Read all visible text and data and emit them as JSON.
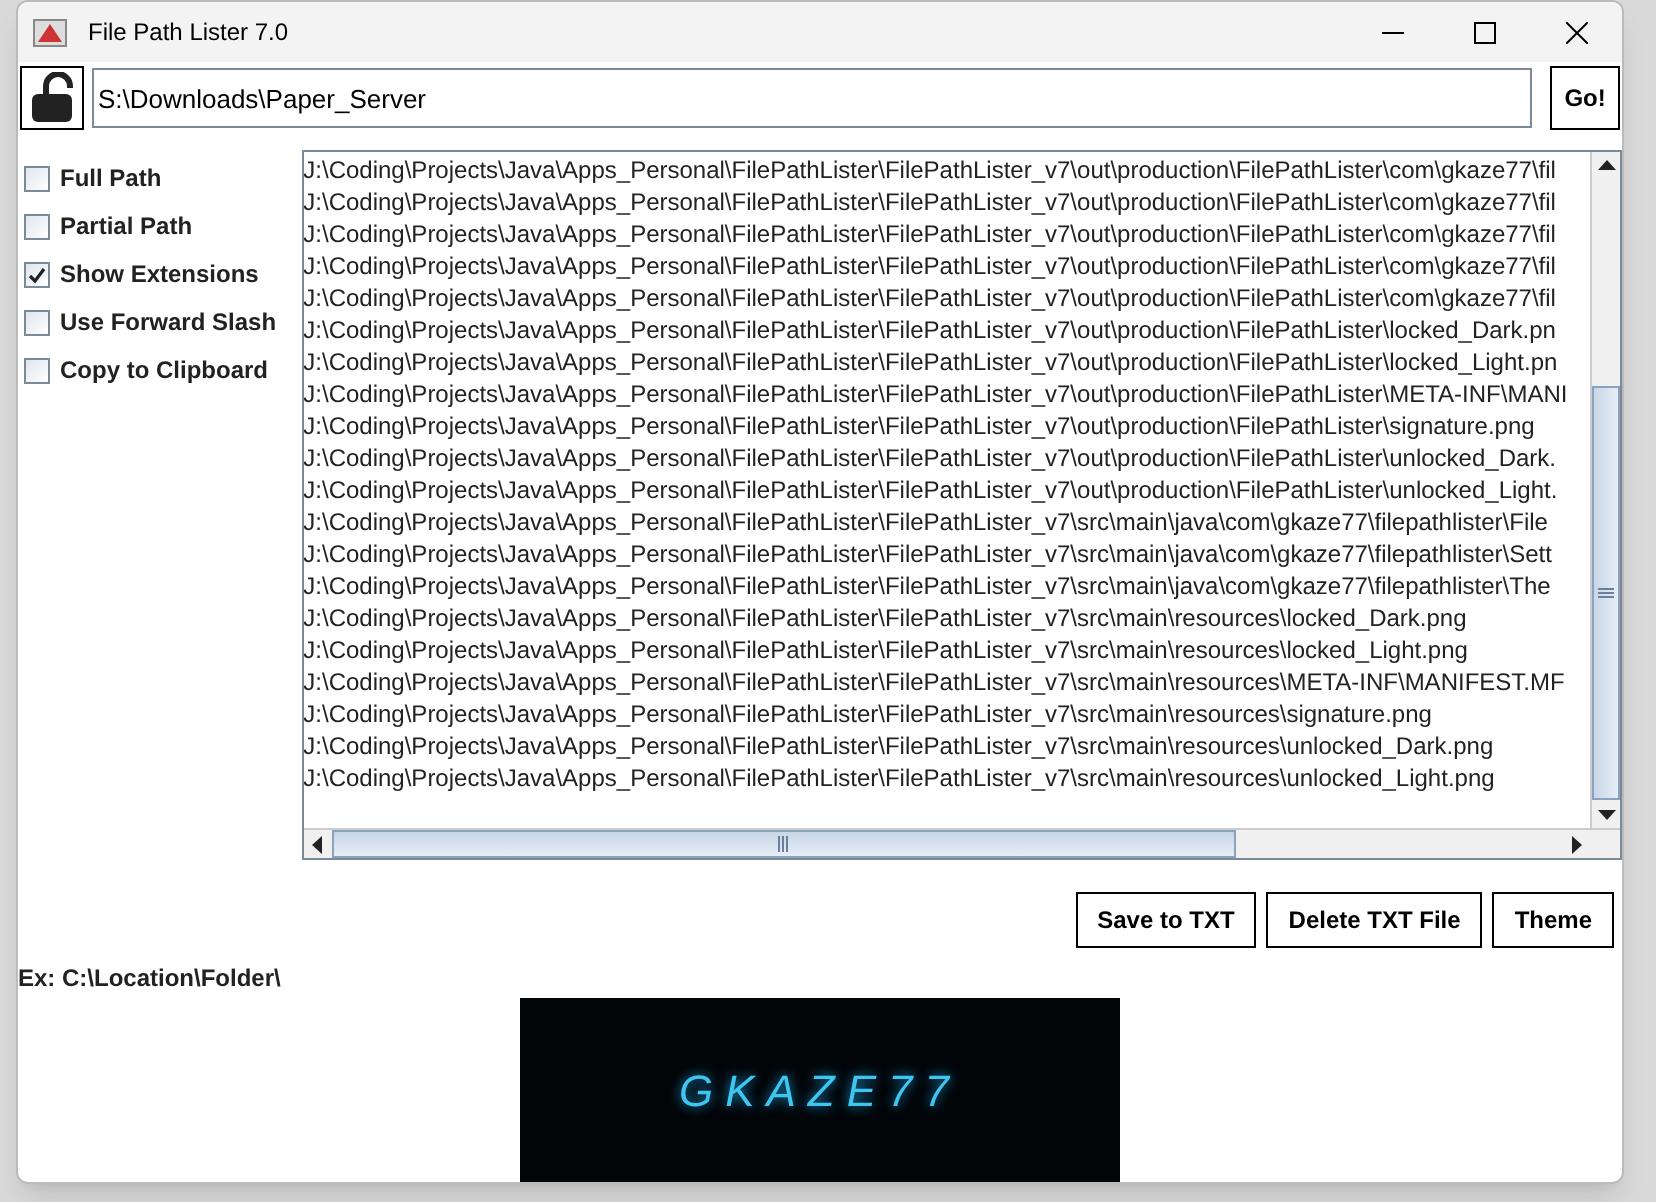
{
  "window": {
    "title": "File Path Lister 7.0"
  },
  "path_field": {
    "value": "S:\\Downloads\\Paper_Server"
  },
  "lock": {
    "locked": false
  },
  "go_button": "Go!",
  "options": [
    {
      "label": "Full Path",
      "checked": false
    },
    {
      "label": "Partial Path",
      "checked": false
    },
    {
      "label": "Show Extensions",
      "checked": true
    },
    {
      "label": "Use Forward Slash",
      "checked": false
    },
    {
      "label": "Copy to Clipboard",
      "checked": false
    }
  ],
  "file_list": [
    "J:\\Coding\\Projects\\Java\\Apps_Personal\\FilePathLister\\FilePathLister_v7\\out\\production\\FilePathLister\\com\\gkaze77\\fil",
    "J:\\Coding\\Projects\\Java\\Apps_Personal\\FilePathLister\\FilePathLister_v7\\out\\production\\FilePathLister\\com\\gkaze77\\fil",
    "J:\\Coding\\Projects\\Java\\Apps_Personal\\FilePathLister\\FilePathLister_v7\\out\\production\\FilePathLister\\com\\gkaze77\\fil",
    "J:\\Coding\\Projects\\Java\\Apps_Personal\\FilePathLister\\FilePathLister_v7\\out\\production\\FilePathLister\\com\\gkaze77\\fil",
    "J:\\Coding\\Projects\\Java\\Apps_Personal\\FilePathLister\\FilePathLister_v7\\out\\production\\FilePathLister\\com\\gkaze77\\fil",
    "J:\\Coding\\Projects\\Java\\Apps_Personal\\FilePathLister\\FilePathLister_v7\\out\\production\\FilePathLister\\locked_Dark.pn",
    "J:\\Coding\\Projects\\Java\\Apps_Personal\\FilePathLister\\FilePathLister_v7\\out\\production\\FilePathLister\\locked_Light.pn",
    "J:\\Coding\\Projects\\Java\\Apps_Personal\\FilePathLister\\FilePathLister_v7\\out\\production\\FilePathLister\\META-INF\\MANI",
    "J:\\Coding\\Projects\\Java\\Apps_Personal\\FilePathLister\\FilePathLister_v7\\out\\production\\FilePathLister\\signature.png",
    "J:\\Coding\\Projects\\Java\\Apps_Personal\\FilePathLister\\FilePathLister_v7\\out\\production\\FilePathLister\\unlocked_Dark.",
    "J:\\Coding\\Projects\\Java\\Apps_Personal\\FilePathLister\\FilePathLister_v7\\out\\production\\FilePathLister\\unlocked_Light.",
    "J:\\Coding\\Projects\\Java\\Apps_Personal\\FilePathLister\\FilePathLister_v7\\src\\main\\java\\com\\gkaze77\\filepathlister\\File",
    "J:\\Coding\\Projects\\Java\\Apps_Personal\\FilePathLister\\FilePathLister_v7\\src\\main\\java\\com\\gkaze77\\filepathlister\\Sett",
    "J:\\Coding\\Projects\\Java\\Apps_Personal\\FilePathLister\\FilePathLister_v7\\src\\main\\java\\com\\gkaze77\\filepathlister\\The",
    "J:\\Coding\\Projects\\Java\\Apps_Personal\\FilePathLister\\FilePathLister_v7\\src\\main\\resources\\locked_Dark.png",
    "J:\\Coding\\Projects\\Java\\Apps_Personal\\FilePathLister\\FilePathLister_v7\\src\\main\\resources\\locked_Light.png",
    "J:\\Coding\\Projects\\Java\\Apps_Personal\\FilePathLister\\FilePathLister_v7\\src\\main\\resources\\META-INF\\MANIFEST.MF",
    "J:\\Coding\\Projects\\Java\\Apps_Personal\\FilePathLister\\FilePathLister_v7\\src\\main\\resources\\signature.png",
    "J:\\Coding\\Projects\\Java\\Apps_Personal\\FilePathLister\\FilePathLister_v7\\src\\main\\resources\\unlocked_Dark.png",
    "J:\\Coding\\Projects\\Java\\Apps_Personal\\FilePathLister\\FilePathLister_v7\\src\\main\\resources\\unlocked_Light.png"
  ],
  "buttons": [
    "Save to TXT",
    "Delete TXT File",
    "Theme"
  ],
  "hint": "Ex: C:\\Location\\Folder\\",
  "banner": {
    "text": "GKAZE77"
  }
}
